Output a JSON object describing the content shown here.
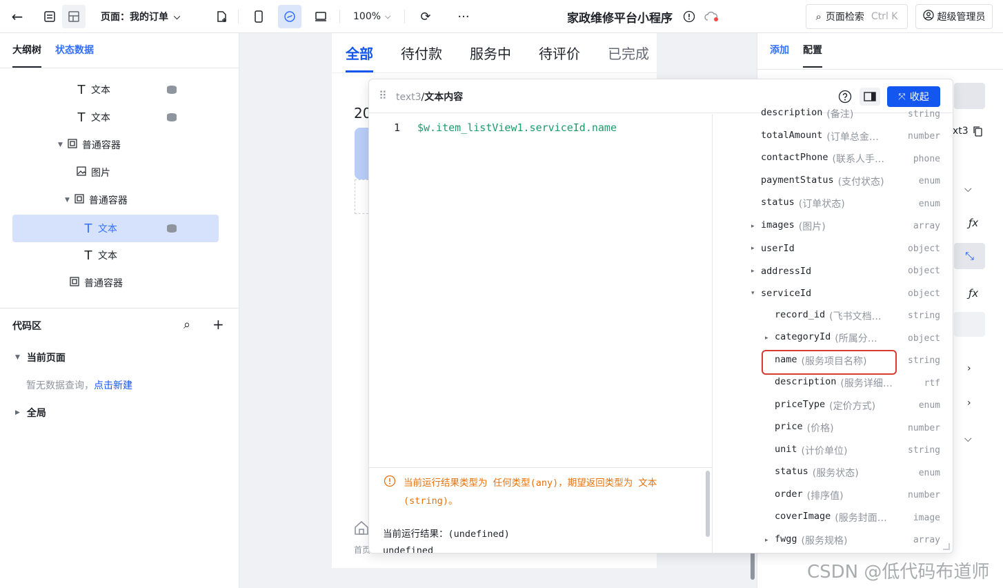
{
  "topbar": {
    "page_label": "页面：我的订单",
    "zoom": "100%",
    "app_title": "家政维修平台小程序",
    "search_label": "页面检索",
    "search_shortcut": "Ctrl K",
    "user_label": "超级管理员"
  },
  "left": {
    "tabs": [
      "大纲树",
      "状态数据"
    ],
    "tree": [
      {
        "label": "文本",
        "icon": "text-icon"
      },
      {
        "label": "文本",
        "icon": "text-icon"
      },
      {
        "label": "普通容器",
        "icon": "container-icon"
      },
      {
        "label": "图片",
        "icon": "image-icon"
      },
      {
        "label": "普通容器",
        "icon": "container-icon"
      },
      {
        "label": "文本",
        "icon": "text-icon"
      },
      {
        "label": "文本",
        "icon": "text-icon"
      },
      {
        "label": "普通容器",
        "icon": "container-icon"
      }
    ],
    "code_area": "代码区",
    "current_page": "当前页面",
    "empty_hint": "暂无数据查询，",
    "create_link": "点击新建",
    "global": "全局"
  },
  "phone": {
    "tabs": [
      "全部",
      "待付款",
      "服务中",
      "待评价",
      "已完成"
    ],
    "partial_text": "20",
    "home_label": "首页"
  },
  "right": {
    "tabs": [
      "添加",
      "配置"
    ],
    "partial_label": "xt3"
  },
  "popup": {
    "path_prefix": "text3",
    "path_sep": "/",
    "path_title": "文本内容",
    "collapse_label": "收起",
    "line_no": "1",
    "code": "$w.item_listView1.serviceId.name",
    "warning": "当前运行结果类型为 任何类型(any)，期望返回类型为 文本(string)。",
    "result_label": "当前运行结果：",
    "result_value": "(undefined)",
    "result_partial": "undefined",
    "fields": [
      {
        "name": "description",
        "desc": "(备注)",
        "type": "string",
        "indent": 0,
        "caret": ""
      },
      {
        "name": "totalAmount",
        "desc": "(订单总金…",
        "type": "number",
        "indent": 0,
        "caret": ""
      },
      {
        "name": "contactPhone",
        "desc": "(联系人手…",
        "type": "phone",
        "indent": 0,
        "caret": ""
      },
      {
        "name": "paymentStatus",
        "desc": "(支付状态)",
        "type": "enum",
        "indent": 0,
        "caret": ""
      },
      {
        "name": "status",
        "desc": "(订单状态)",
        "type": "enum",
        "indent": 0,
        "caret": ""
      },
      {
        "name": "images",
        "desc": "(图片)",
        "type": "array",
        "indent": 0,
        "caret": "▸"
      },
      {
        "name": "userId",
        "desc": "",
        "type": "object",
        "indent": 0,
        "caret": "▸"
      },
      {
        "name": "addressId",
        "desc": "",
        "type": "object",
        "indent": 0,
        "caret": "▸"
      },
      {
        "name": "serviceId",
        "desc": "",
        "type": "object",
        "indent": 0,
        "caret": "▾"
      },
      {
        "name": "record_id",
        "desc": "(飞书文档…",
        "type": "string",
        "indent": 1,
        "caret": ""
      },
      {
        "name": "categoryId",
        "desc": "(所属分…",
        "type": "object",
        "indent": 1,
        "caret": "▸"
      },
      {
        "name": "name",
        "desc": "(服务项目名称)",
        "type": "string",
        "indent": 1,
        "caret": ""
      },
      {
        "name": "description",
        "desc": "(服务详细…",
        "type": "rtf",
        "indent": 1,
        "caret": ""
      },
      {
        "name": "priceType",
        "desc": "(定价方式)",
        "type": "enum",
        "indent": 1,
        "caret": ""
      },
      {
        "name": "price",
        "desc": "(价格)",
        "type": "number",
        "indent": 1,
        "caret": ""
      },
      {
        "name": "unit",
        "desc": "(计价单位)",
        "type": "string",
        "indent": 1,
        "caret": ""
      },
      {
        "name": "status",
        "desc": "(服务状态)",
        "type": "enum",
        "indent": 1,
        "caret": ""
      },
      {
        "name": "order",
        "desc": "(排序值)",
        "type": "number",
        "indent": 1,
        "caret": ""
      },
      {
        "name": "coverImage",
        "desc": "(服务封面…",
        "type": "image",
        "indent": 1,
        "caret": ""
      },
      {
        "name": "fwgg",
        "desc": "(服务规格)",
        "type": "array",
        "indent": 1,
        "caret": "▸"
      }
    ]
  },
  "watermark": "CSDN @低代码布道师",
  "colors": {
    "accent": "#1456f0",
    "link": "#3370ff",
    "warning": "#e8710a",
    "code": "#1a9c6b",
    "highlight": "#d83931"
  }
}
